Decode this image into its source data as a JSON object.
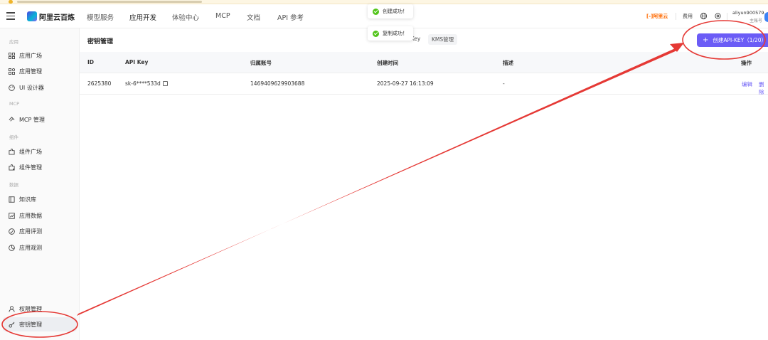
{
  "topbar": {
    "brand": "阿里云百炼",
    "nav": [
      "模型服务",
      "应用开发",
      "体验中心",
      "MCP",
      "文档",
      "API 参考"
    ],
    "aliyun": "[-]阿里云",
    "fee": "费用",
    "user_name": "aliyun900579...",
    "user_role": "主账号"
  },
  "sidebar": {
    "groups": {
      "app": "应用",
      "mcp": "MCP",
      "component": "组件",
      "data": "数据"
    },
    "items": {
      "app_square": "应用广场",
      "app_manage": "应用管理",
      "ui_designer": "UI 设计器",
      "mcp_manage": "MCP 管理",
      "comp_square": "组件广场",
      "comp_manage": "组件管理",
      "knowledge": "知识库",
      "app_data": "应用数据",
      "app_eval": "应用评测",
      "app_observe": "应用观测",
      "permission": "权限管理",
      "key_manage": "密钥管理"
    }
  },
  "main": {
    "title": "密钥管理",
    "tab_apikey": "-Key",
    "tab_kms": "KMS管理",
    "create_button": "创建API-KEY（1/20）",
    "columns": [
      "ID",
      "API Key",
      "归属账号",
      "创建时间",
      "描述",
      "操作"
    ],
    "rows": [
      {
        "id": "2625380",
        "api_key": "sk-6****533d",
        "account": "1469409629903688",
        "created": "2025-09-27 16:13:09",
        "desc": "-",
        "edit": "编辑",
        "delete": "删除"
      }
    ]
  },
  "toasts": {
    "create_success": "创建成功！",
    "copy_success": "复制成功！"
  },
  "colors": {
    "accent": "#6b5cf6",
    "annotation": "#e53935",
    "success": "#52c41a"
  }
}
